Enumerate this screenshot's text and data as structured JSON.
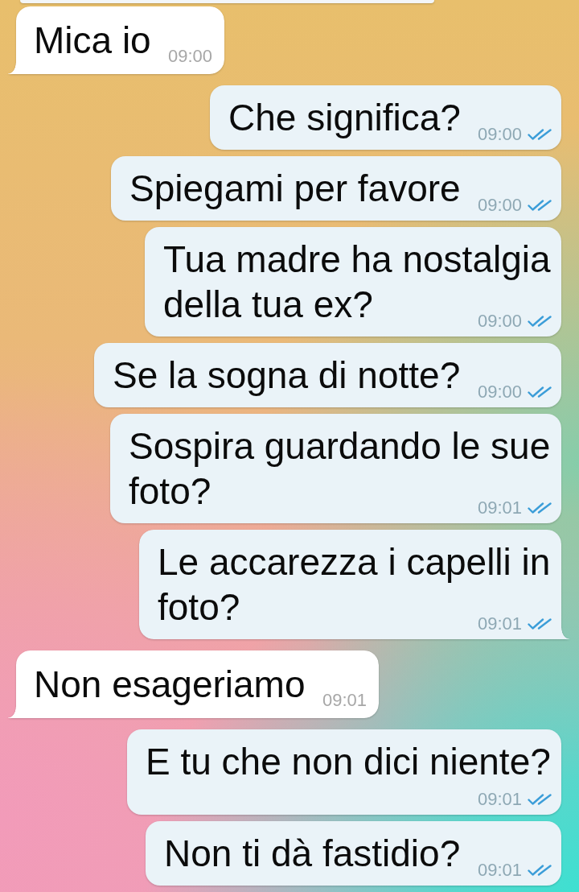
{
  "messages": [
    {
      "kind": "clipped"
    },
    {
      "kind": "incoming",
      "text": "Mica io",
      "time": "09:00",
      "tail": true
    },
    {
      "kind": "outgoing",
      "text": "Che significa?",
      "time": "09:00",
      "read": true,
      "tail": false
    },
    {
      "kind": "outgoing",
      "text": "Spiegami per favore",
      "time": "09:00",
      "read": true,
      "tail": false
    },
    {
      "kind": "outgoing",
      "text": "Tua madre ha nostalgia della tua ex?",
      "time": "09:00",
      "read": true,
      "tail": false
    },
    {
      "kind": "outgoing",
      "text": "Se la sogna di notte?",
      "time": "09:00",
      "read": true,
      "tail": false
    },
    {
      "kind": "outgoing",
      "text": "Sospira guardando le sue foto?",
      "time": "09:01",
      "read": true,
      "tail": false
    },
    {
      "kind": "outgoing",
      "text": "Le accarezza i capelli in foto?",
      "time": "09:01",
      "read": true,
      "tail": true
    },
    {
      "kind": "incoming",
      "text": "Non esageriamo",
      "time": "09:01",
      "tail": true
    },
    {
      "kind": "outgoing",
      "text": "E tu che non dici niente?",
      "time": "09:01",
      "read": true,
      "tail": false
    },
    {
      "kind": "outgoing",
      "text": "Non ti dà fastidio?",
      "time": "09:01",
      "read": true,
      "tail": false
    }
  ]
}
